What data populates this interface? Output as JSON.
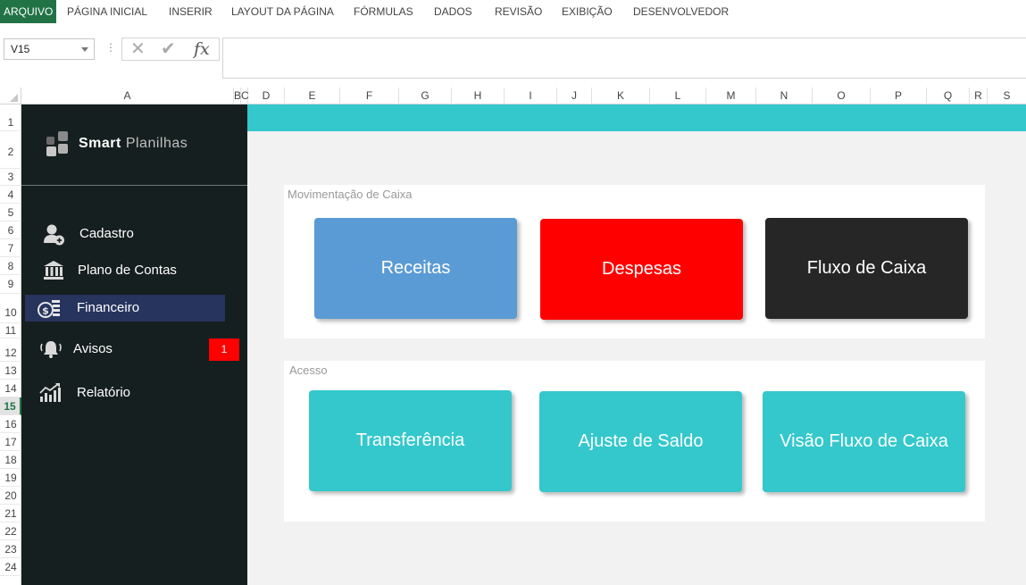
{
  "ribbon": {
    "tabs": [
      "ARQUIVO",
      "PÁGINA INICIAL",
      "INSERIR",
      "LAYOUT DA PÁGINA",
      "FÓRMULAS",
      "DADOS",
      "REVISÃO",
      "EXIBIÇÃO",
      "DESENVOLVEDOR"
    ]
  },
  "formula_bar": {
    "name_box": "V15",
    "cancel_icon": "✕",
    "enter_icon": "✔",
    "fx_label": "fx",
    "formula_value": ""
  },
  "columns": [
    "A",
    "B",
    "C",
    "D",
    "E",
    "F",
    "G",
    "H",
    "I",
    "J",
    "K",
    "L",
    "M",
    "N",
    "O",
    "P",
    "Q",
    "R",
    "S"
  ],
  "rows": [
    "1",
    "2",
    "3",
    "4",
    "5",
    "6",
    "7",
    "8",
    "9",
    "10",
    "11",
    "12",
    "13",
    "14",
    "15",
    "16",
    "17",
    "18",
    "19",
    "20",
    "21",
    "22",
    "23",
    "24"
  ],
  "selected_row": "15",
  "sidebar": {
    "brand_bold": "Smart",
    "brand_light": "Planilhas",
    "items": [
      {
        "label": "Cadastro",
        "icon": "user-add-icon"
      },
      {
        "label": "Plano de Contas",
        "icon": "bank-icon"
      },
      {
        "label": "Financeiro",
        "icon": "money-icon",
        "active": true
      },
      {
        "label": "Avisos",
        "icon": "bell-icon"
      },
      {
        "label": "Relatório",
        "icon": "chart-icon"
      }
    ],
    "alerts_badge": "1"
  },
  "main": {
    "accent_color": "#34c8cc",
    "cash_panel": {
      "title": "Movimentação de Caixa",
      "buttons": [
        {
          "label": "Receitas",
          "color": "#5b9bd5"
        },
        {
          "label": "Despesas",
          "color": "#ff0000"
        },
        {
          "label": "Fluxo de Caixa",
          "color": "#262626"
        }
      ]
    },
    "access_panel": {
      "title": "Acesso",
      "buttons": [
        {
          "label": "Transferência",
          "color": "#34c8cc"
        },
        {
          "label": "Ajuste de Saldo",
          "color": "#34c8cc"
        },
        {
          "label": "Visão Fluxo de Caixa",
          "color": "#34c8cc"
        }
      ]
    }
  }
}
